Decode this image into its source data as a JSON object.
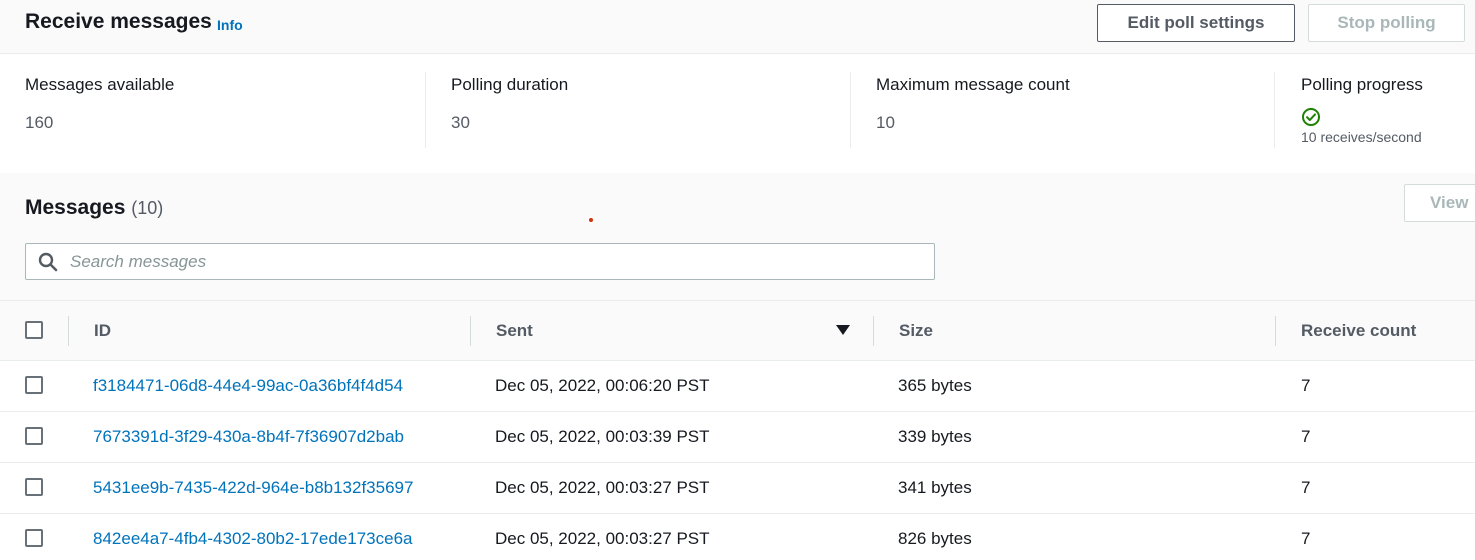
{
  "header": {
    "title": "Receive messages",
    "info_label": "Info",
    "edit_button": "Edit poll settings",
    "stop_button": "Stop polling"
  },
  "stats": {
    "messages_available": {
      "label": "Messages available",
      "value": "160"
    },
    "polling_duration": {
      "label": "Polling duration",
      "value": "30"
    },
    "max_message_count": {
      "label": "Maximum message count",
      "value": "10"
    },
    "polling_progress": {
      "label": "Polling progress",
      "value": "10 receives/second",
      "icon": "check-circle-icon",
      "icon_color": "#1d8102"
    }
  },
  "messages": {
    "title": "Messages",
    "count": "(10)",
    "view_button": "View",
    "search_placeholder": "Search messages"
  },
  "table": {
    "columns": [
      "ID",
      "Sent",
      "Size",
      "Receive count"
    ],
    "sorted_column": "Sent",
    "sort_direction": "descending",
    "rows": [
      {
        "id": "f3184471-06d8-44e4-99ac-0a36bf4f4d54",
        "sent": "Dec 05, 2022, 00:06:20 PST",
        "size": "365 bytes",
        "receive_count": "7"
      },
      {
        "id": "7673391d-3f29-430a-8b4f-7f36907d2bab",
        "sent": "Dec 05, 2022, 00:03:39 PST",
        "size": "339 bytes",
        "receive_count": "7"
      },
      {
        "id": "5431ee9b-7435-422d-964e-b8b132f35697",
        "sent": "Dec 05, 2022, 00:03:27 PST",
        "size": "341 bytes",
        "receive_count": "7"
      },
      {
        "id": "842ee4a7-4fb4-4302-80b2-17ede173ce6a",
        "sent": "Dec 05, 2022, 00:03:27 PST",
        "size": "826 bytes",
        "receive_count": "7"
      }
    ]
  },
  "colors": {
    "link": "#0073bb",
    "success": "#1d8102",
    "header_bg": "#fafafa",
    "border": "#eaeded"
  }
}
